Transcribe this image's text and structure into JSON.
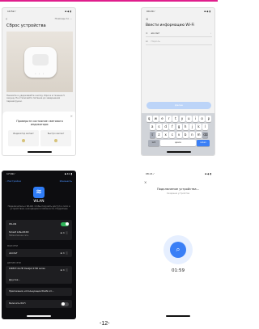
{
  "page_number": "-12-",
  "screen_reset": {
    "status_time": "10:52 ⁄",
    "status_icons": "▪ ◆ ▮",
    "back_glyph": "‹",
    "help_label": "Помощь по ...",
    "title": "Сброс устройства",
    "description": "Нажмите и удерживайте кнопку сброса в течение 5 секунд. Не отключайте питание до завершения перезагрузки.",
    "sheet_close_glyph": "×",
    "sheet_question": "Проверьте состояние светового индикатора:",
    "option_left_label": "Индикатор мигает",
    "option_right_label": "Быстро мигает"
  },
  "screen_wifi_info": {
    "status_time": "09:20 ⁄",
    "status_icons": "▪ ◆ ▮",
    "close_glyph": "×",
    "title": "Ввести информацию Wi-Fi",
    "network_icon": "≋",
    "network_value": "abcdef",
    "password_icon": "⊡",
    "password_placeholder": "Пароль",
    "dropdown_glyph": "›",
    "next_button": "Далее",
    "keyboard_row1": [
      "q",
      "w",
      "e",
      "r",
      "t",
      "y",
      "u",
      "i",
      "o",
      "p"
    ],
    "keyboard_row2": [
      "a",
      "s",
      "d",
      "f",
      "g",
      "h",
      "j",
      "k",
      "l"
    ],
    "keyboard_row3": [
      "⇧",
      "z",
      "x",
      "c",
      "v",
      "b",
      "n",
      "m",
      "⌫"
    ],
    "key_numbers": "123",
    "key_space": "space",
    "key_go": "return"
  },
  "screen_wlan": {
    "status_time": "17:09 ⁄",
    "status_icons": "▪ 41 ▮",
    "nav_back": "‹ Настройки",
    "nav_right": "Изменить",
    "wifi_icon": "≋",
    "title": "WLAN",
    "description": "Подключитесь к WLAN, чтобы получить доступ к сети и устройствам, находящимся поблизости. Подробнее",
    "wlan_label": "WLAN",
    "current_network": "Smart Life-XXXX",
    "current_network_sub": "Небезопасная сеть",
    "my_networks_label": "МОИ СЕТИ",
    "my_network_1": "abcdef",
    "other_networks_label": "ДРУГИЕ СЕТИ",
    "other_network_1": "DIRECT-4A-HP DeskJet 2700 series",
    "other_network_2": "Другая...",
    "apps_row": "Приложения, использующие WLAN и С...",
    "auto_join": "Включить Wi-Fi",
    "signal_glyph": "▪ ≋ ⓘ"
  },
  "screen_connecting": {
    "status_time": "08:21 ⁄",
    "status_icons": "▪ ◆ ▮",
    "close_glyph": "×",
    "title": "Подключение устройства...",
    "subtitle": "Ожидание устройства",
    "search_icon": "⌕",
    "timer": "01:59"
  },
  "colors": {
    "accent_magenta": "#e01e8c",
    "primary_blue": "#3a7ff6",
    "toggle_green": "#2fb559"
  }
}
